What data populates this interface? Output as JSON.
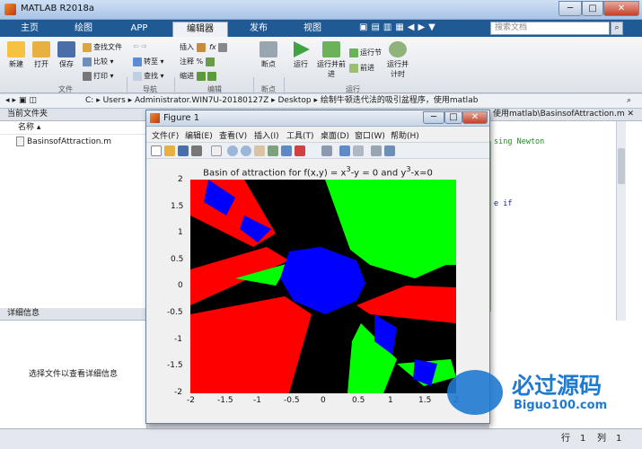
{
  "window": {
    "title": "MATLAB R2018a",
    "controls": [
      "─",
      "□",
      "✕"
    ]
  },
  "tabs": [
    "主页",
    "绘图",
    "APP",
    "编辑器",
    "发布",
    "视图"
  ],
  "active_tab": "编辑器",
  "search": {
    "placeholder": "搜索文档"
  },
  "toolstrip": {
    "file": {
      "new": "新建",
      "open": "打开",
      "save": "保存",
      "find_files": "查找文件",
      "compare": "比较",
      "print": "打印",
      "group": "文件"
    },
    "nav": {
      "goto": "转至",
      "find": "查找",
      "group": "导航"
    },
    "edit": {
      "insert": "插入",
      "comment": "注释",
      "indent": "缩进",
      "group": "编辑"
    },
    "breakpoints": {
      "label": "断点",
      "group": "断点"
    },
    "run": {
      "run": "运行",
      "run_advance": "运行并前进",
      "run_section": "运行节",
      "advance": "前进",
      "run_time": "运行并计时",
      "group": "运行"
    }
  },
  "address": {
    "path": [
      "C:",
      "Users",
      "Administrator.WIN7U-20180127Z",
      "Desktop",
      "绘制牛顿迭代法的吸引盆程序，使用matlab"
    ]
  },
  "current_folder": {
    "header": "当前文件夹",
    "column": "名称",
    "files": [
      "BasinsofAttraction.m"
    ]
  },
  "details": {
    "header": "详细信息",
    "message": "选择文件以查看详细信息"
  },
  "editor": {
    "tab_path": "使用matlab\\BasinsofAttraction.m",
    "code_lines": [
      "sing Newton",
      "e if"
    ]
  },
  "status": {
    "row_label": "行",
    "row": "1",
    "col_label": "列",
    "col": "1"
  },
  "figure": {
    "title": "Figure 1",
    "menus": [
      "文件(F)",
      "编辑(E)",
      "查看(V)",
      "插入(I)",
      "工具(T)",
      "桌面(D)",
      "窗口(W)",
      "帮助(H)"
    ],
    "plot_title_parts": [
      "Basin of attraction for f(x,y) = x",
      "3",
      "-y = 0 and y",
      "3",
      "-x=0"
    ],
    "xticks": [
      "-2",
      "-1.5",
      "-1",
      "-0.5",
      "0",
      "0.5",
      "1",
      "1.5",
      "2"
    ],
    "yticks": [
      "2",
      "1.5",
      "1",
      "0.5",
      "0",
      "-0.5",
      "-1",
      "-1.5",
      "-2"
    ]
  },
  "watermark": {
    "text": "必过源码",
    "url": "Biguo100.com"
  }
}
